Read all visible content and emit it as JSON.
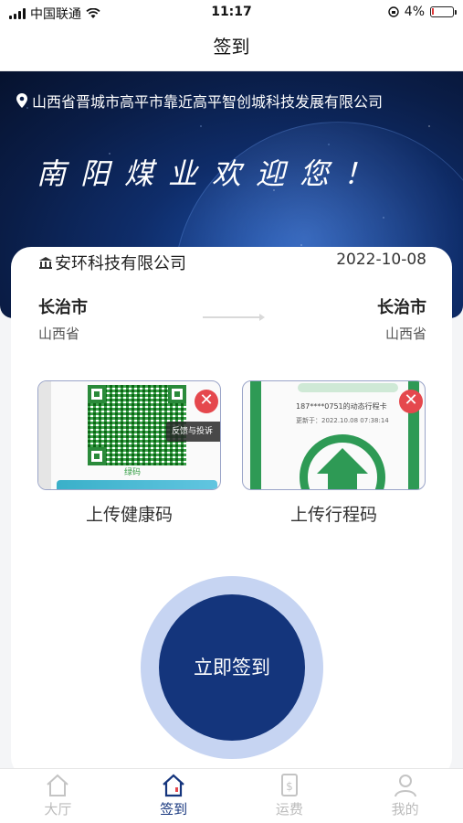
{
  "status_bar": {
    "carrier": "中国联通",
    "time": "11:17",
    "battery": "4%"
  },
  "nav": {
    "title": "签到"
  },
  "banner": {
    "location": "山西省晋城市高平市靠近高平智创城科技发展有限公司",
    "welcome": "南阳煤业欢迎您！"
  },
  "trip": {
    "company": "安环科技有限公司",
    "date": "2022-10-08",
    "from_city": "长治市",
    "from_province": "山西省",
    "to_city": "长治市",
    "to_province": "山西省"
  },
  "uploads": {
    "health_label": "上传健康码",
    "health_caption": "绿码",
    "health_feedback": "反馈与投诉",
    "travel_label": "上传行程码",
    "travel_line1": "187****0751的动态行程卡",
    "travel_line2": "更新于：2022.10.08 07:38:14"
  },
  "sign_button": "立即签到",
  "tabs": [
    {
      "label": "大厅",
      "icon": "home-icon",
      "active": false
    },
    {
      "label": "签到",
      "icon": "home-icon",
      "active": true
    },
    {
      "label": "运费",
      "icon": "dollar-doc-icon",
      "active": false
    },
    {
      "label": "我的",
      "icon": "user-icon",
      "active": false
    }
  ],
  "colors": {
    "primary": "#14357c",
    "ring": "#c6d4f2",
    "delete": "#e5484d",
    "trip_green": "#2e9a55"
  }
}
